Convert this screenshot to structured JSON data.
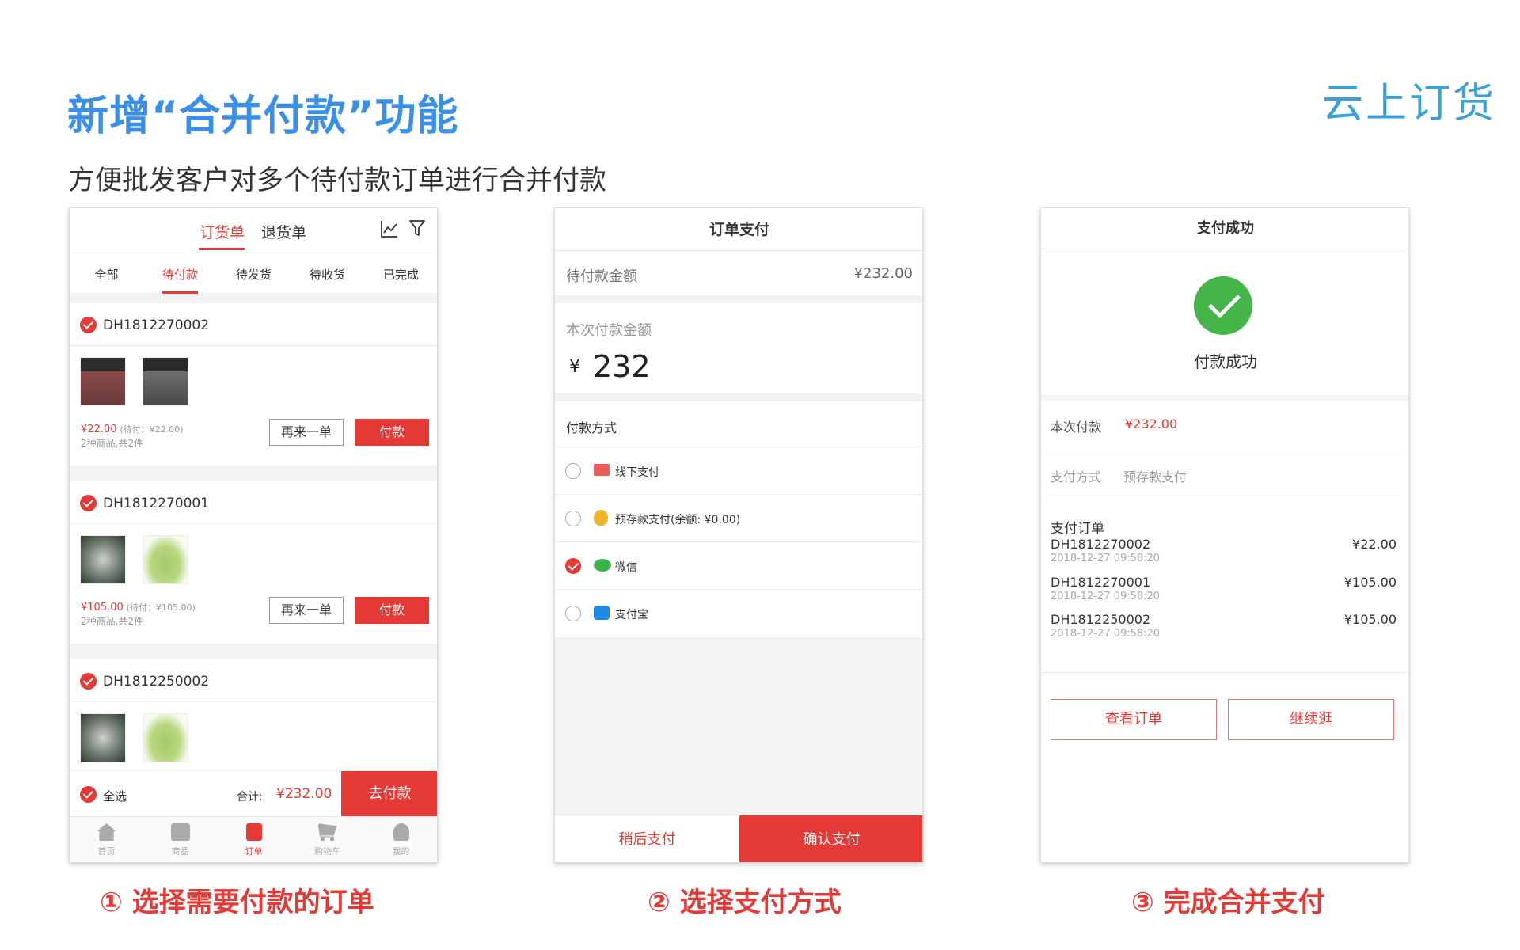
{
  "header": {
    "title": "新增“合并付款”功能",
    "subtitle": "方便批发客户对多个待付款订单进行合并付款",
    "logo_text": "云上订货"
  },
  "captions": [
    "① 选择需要付款的订单",
    "② 选择支付方式",
    "③ 完成合并支付"
  ],
  "colors": {
    "accent_red": "#e53935",
    "title_blue": "#3a8fe6",
    "success_green": "#43b549"
  },
  "screen1": {
    "tabs": [
      "订货单",
      "退货单"
    ],
    "active_tab": 0,
    "icons": [
      "chart-icon",
      "filter-icon"
    ],
    "status_tabs": [
      "全部",
      "待付款",
      "待发货",
      "待收货",
      "已完成"
    ],
    "active_status": 1,
    "orders": [
      {
        "no": "DH1812270002",
        "price": "¥22.00",
        "pending": "(待付：¥22.00)",
        "count": "2种商品,共2件",
        "reorder": "再来一单",
        "pay": "付款"
      },
      {
        "no": "DH1812270001",
        "price": "¥105.00",
        "pending": "(待付：¥105.00)",
        "count": "2种商品,共2件",
        "reorder": "再来一单",
        "pay": "付款"
      },
      {
        "no": "DH1812250002"
      }
    ],
    "select_all": "全选",
    "total_label": "合计:",
    "total_value": "¥232.00",
    "go_pay": "去付款",
    "nav": [
      "首页",
      "商品",
      "订单",
      "购物车",
      "我的"
    ],
    "active_nav": 2
  },
  "screen2": {
    "title": "订单支付",
    "pending_label": "待付款金额",
    "pending_value": "¥232.00",
    "this_label": "本次付款金额",
    "currency": "¥",
    "this_value": "232",
    "method_label": "付款方式",
    "methods": [
      "线下支付",
      "预存款支付(余额: ¥0.00)",
      "微信",
      "支付宝"
    ],
    "selected_method": 2,
    "later": "稍后支付",
    "confirm": "确认支付"
  },
  "screen3": {
    "title": "支付成功",
    "success_text": "付款成功",
    "this_pay_label": "本次付款",
    "this_pay_value": "¥232.00",
    "method_label": "支付方式",
    "method_value": "预存款支付",
    "orders_label": "支付订单",
    "orders": [
      {
        "no": "DH1812270002",
        "time": "2018-12-27 09:58:20",
        "amount": "¥22.00"
      },
      {
        "no": "DH1812270001",
        "time": "2018-12-27 09:58:20",
        "amount": "¥105.00"
      },
      {
        "no": "DH1812250002",
        "time": "2018-12-27 09:58:20",
        "amount": "¥105.00"
      }
    ],
    "view_order": "查看订单",
    "continue": "继续逛"
  }
}
